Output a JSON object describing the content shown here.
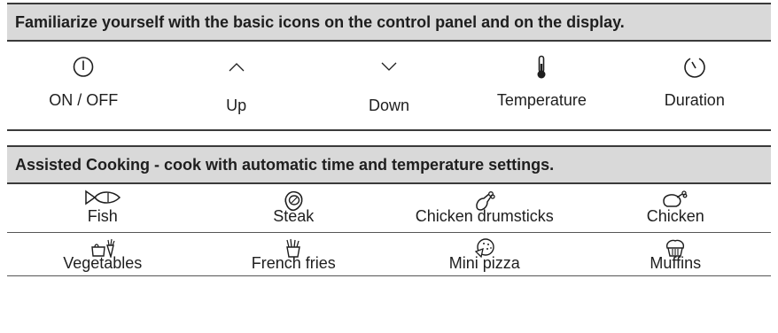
{
  "panel_section": {
    "title": "Familiarize yourself with the basic icons on the control panel and on the display.",
    "items": [
      {
        "label": "ON / OFF",
        "icon": "power-icon"
      },
      {
        "label": "Up",
        "icon": "chevron-up-icon"
      },
      {
        "label": "Down",
        "icon": "chevron-down-icon"
      },
      {
        "label": "Temperature",
        "icon": "thermometer-icon"
      },
      {
        "label": "Duration",
        "icon": "timer-icon"
      }
    ]
  },
  "cooking_section": {
    "title": "Assisted Cooking - cook with automatic time and temperature settings.",
    "rows": [
      [
        {
          "label": "Fish",
          "icon": "fish-icon"
        },
        {
          "label": "Steak",
          "icon": "steak-icon"
        },
        {
          "label": "Chicken drumsticks",
          "icon": "drumstick-icon"
        },
        {
          "label": "Chicken",
          "icon": "roast-chicken-icon"
        }
      ],
      [
        {
          "label": "Vegetables",
          "icon": "vegetables-icon"
        },
        {
          "label": "French fries",
          "icon": "french-fries-icon"
        },
        {
          "label": "Mini pizza",
          "icon": "pizza-icon"
        },
        {
          "label": "Muffins",
          "icon": "muffin-icon"
        }
      ]
    ]
  },
  "colors": {
    "header_bg": "#d9d9d9",
    "rule": "#3a3a3a",
    "text": "#1e1e1e"
  }
}
